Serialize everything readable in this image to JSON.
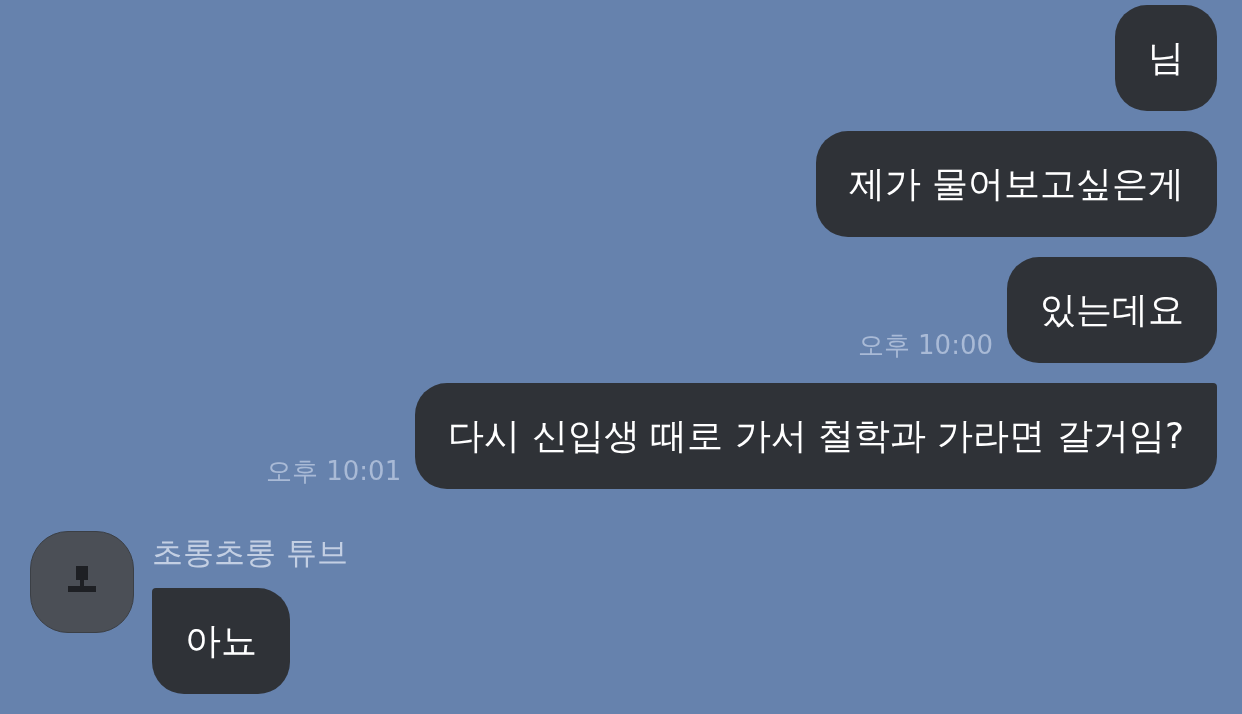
{
  "messages": [
    {
      "kind": "sent",
      "text": "님",
      "tail": false
    },
    {
      "kind": "sent",
      "text": "제가 물어보고싶은게",
      "tail": false
    },
    {
      "kind": "sent",
      "text": "있는데요",
      "time": "오후 10:00",
      "tail": false
    },
    {
      "kind": "sent",
      "text": "다시 신입생 때로 가서 철학과 가라면 갈거임?",
      "time": "오후 10:01",
      "tail": true
    },
    {
      "kind": "received",
      "sender": "초롱초롱 튜브",
      "text": "아뇨",
      "tail": true
    }
  ]
}
